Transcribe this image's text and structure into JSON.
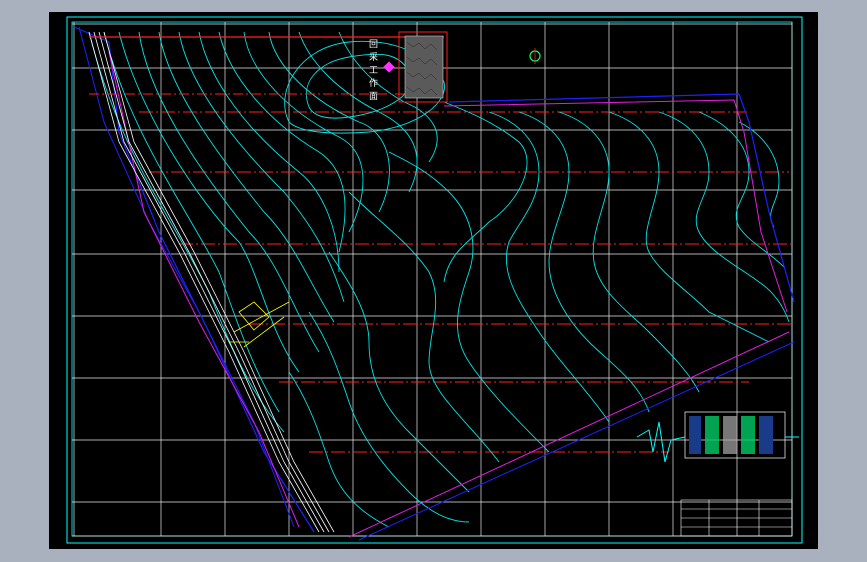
{
  "facility": {
    "label_chars": [
      "回",
      "采",
      "工",
      "作",
      "面"
    ]
  },
  "title_block": {
    "drawing_title": ""
  },
  "colors": {
    "background": "#000000",
    "viewport": "#a9b1bf",
    "frame": "#00ffff",
    "grid": "#ffffff",
    "contour": "#00e5e5",
    "boundary_blue": "#2020ff",
    "boundary_magenta": "#e01ee0",
    "roadway_red": "#ff2020",
    "highlight_yellow": "#ffff00",
    "marker_green": "#00ff66"
  },
  "icons": {
    "survey_point": "magenta-diamond",
    "north_marker": "green-circle-cross"
  }
}
